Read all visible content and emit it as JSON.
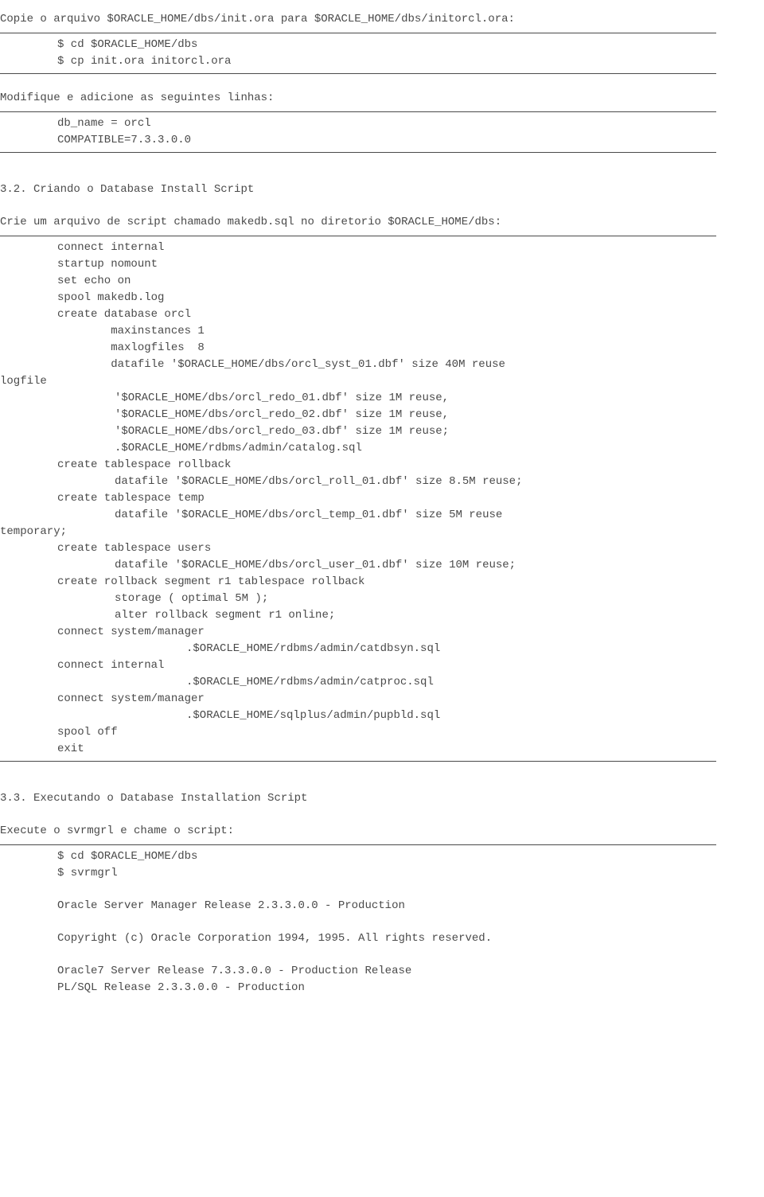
{
  "line01": "Copie o arquivo $ORACLE_HOME/dbs/init.ora para $ORACLE_HOME/dbs/initorcl.ora:",
  "cmd1a": "$ cd $ORACLE_HOME/dbs",
  "cmd1b": "$ cp init.ora initorcl.ora",
  "line02": "Modifique e adicione as seguintes linhas:",
  "cfg1": "db_name = orcl",
  "cfg2": "COMPATIBLE=7.3.3.0.0",
  "h32": "3.2.  Criando o Database Install Script",
  "line03": "Crie um arquivo de script chamado makedb.sql no diretorio $ORACLE_HOME/dbs:",
  "script": "connect internal\nstartup nomount\nset echo on\nspool makedb.log\ncreate database orcl\n        maxinstances 1\n        maxlogfiles  8\n        datafile '$ORACLE_HOME/dbs/orcl_syst_01.dbf' size 40M reuse",
  "logfile": "logfile",
  "redo1": "'$ORACLE_HOME/dbs/orcl_redo_01.dbf' size 1M reuse,",
  "redo2": "'$ORACLE_HOME/dbs/orcl_redo_02.dbf' size 1M reuse,",
  "redo3": "'$ORACLE_HOME/dbs/orcl_redo_03.dbf' size 1M reuse;",
  "catalog": ".$ORACLE_HOME/rdbms/admin/catalog.sql",
  "ts_rollback": "create tablespace rollback",
  "roll_df": "datafile '$ORACLE_HOME/dbs/orcl_roll_01.dbf' size 8.5M reuse;",
  "ts_temp": "create tablespace temp",
  "temp_df": "datafile '$ORACLE_HOME/dbs/orcl_temp_01.dbf' size 5M reuse",
  "temporary": "temporary;",
  "ts_users": "create tablespace users",
  "users_df": "datafile '$ORACLE_HOME/dbs/orcl_user_01.dbf' size 10M reuse;",
  "rb_seg": "create rollback segment r1 tablespace rollback",
  "storage": "storage ( optimal 5M );",
  "alter": "alter rollback segment r1 online;",
  "conn_sys1": "connect system/manager",
  "catdbsyn": ".$ORACLE_HOME/rdbms/admin/catdbsyn.sql",
  "conn_int": "connect internal",
  "catproc": ".$ORACLE_HOME/rdbms/admin/catproc.sql",
  "conn_sys2": "connect system/manager",
  "pupbld": ".$ORACLE_HOME/sqlplus/admin/pupbld.sql",
  "spool_off": "spool off",
  "exit": "exit",
  "h33": "3.3.  Executando o Database Installation Script",
  "line04": "Execute o svrmgrl e chame o script:",
  "cmd3a": "$ cd $ORACLE_HOME/dbs",
  "cmd3b": "$ svrmgrl",
  "out1": "Oracle Server Manager Release 2.3.3.0.0 - Production",
  "out2": "Copyright (c) Oracle Corporation 1994, 1995. All rights reserved.",
  "out3": "Oracle7 Server Release 7.3.3.0.0 - Production Release",
  "out4": "PL/SQL Release 2.3.3.0.0 - Production"
}
